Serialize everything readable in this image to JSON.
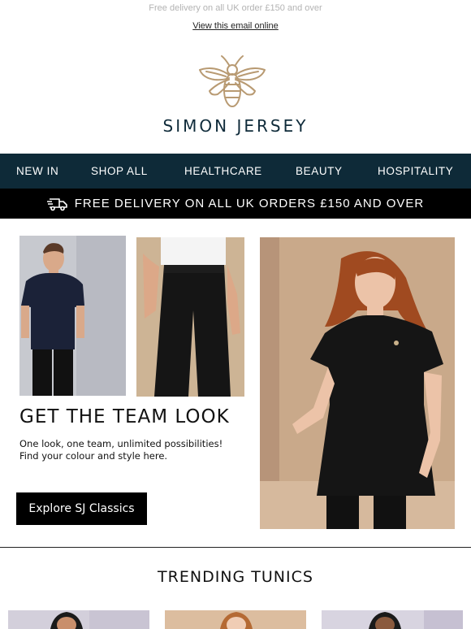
{
  "preheader": "Free delivery on all UK order £150 and over",
  "view_online": "View this email online",
  "brand": {
    "name": "SIMON JERSEY",
    "logo_icon": "bee-icon",
    "navy": "#0e2a38",
    "gold": "#b89a72"
  },
  "nav": {
    "items": [
      {
        "label": "NEW IN"
      },
      {
        "label": "SHOP ALL"
      },
      {
        "label": "HEALTHCARE"
      },
      {
        "label": "BEAUTY"
      },
      {
        "label": "HOSPITALITY"
      }
    ]
  },
  "delivery_bar": {
    "icon": "truck-icon",
    "text": "FREE DELIVERY ON ALL UK ORDERS £150 AND OVER"
  },
  "hero": {
    "headline": "GET THE TEAM LOOK",
    "subcopy_line1": "One look, one team, unlimited possibilities!",
    "subcopy_line2": "Find your colour and style here.",
    "cta_label": "Explore SJ Classics"
  },
  "trending": {
    "title": "TRENDING TUNICS"
  }
}
